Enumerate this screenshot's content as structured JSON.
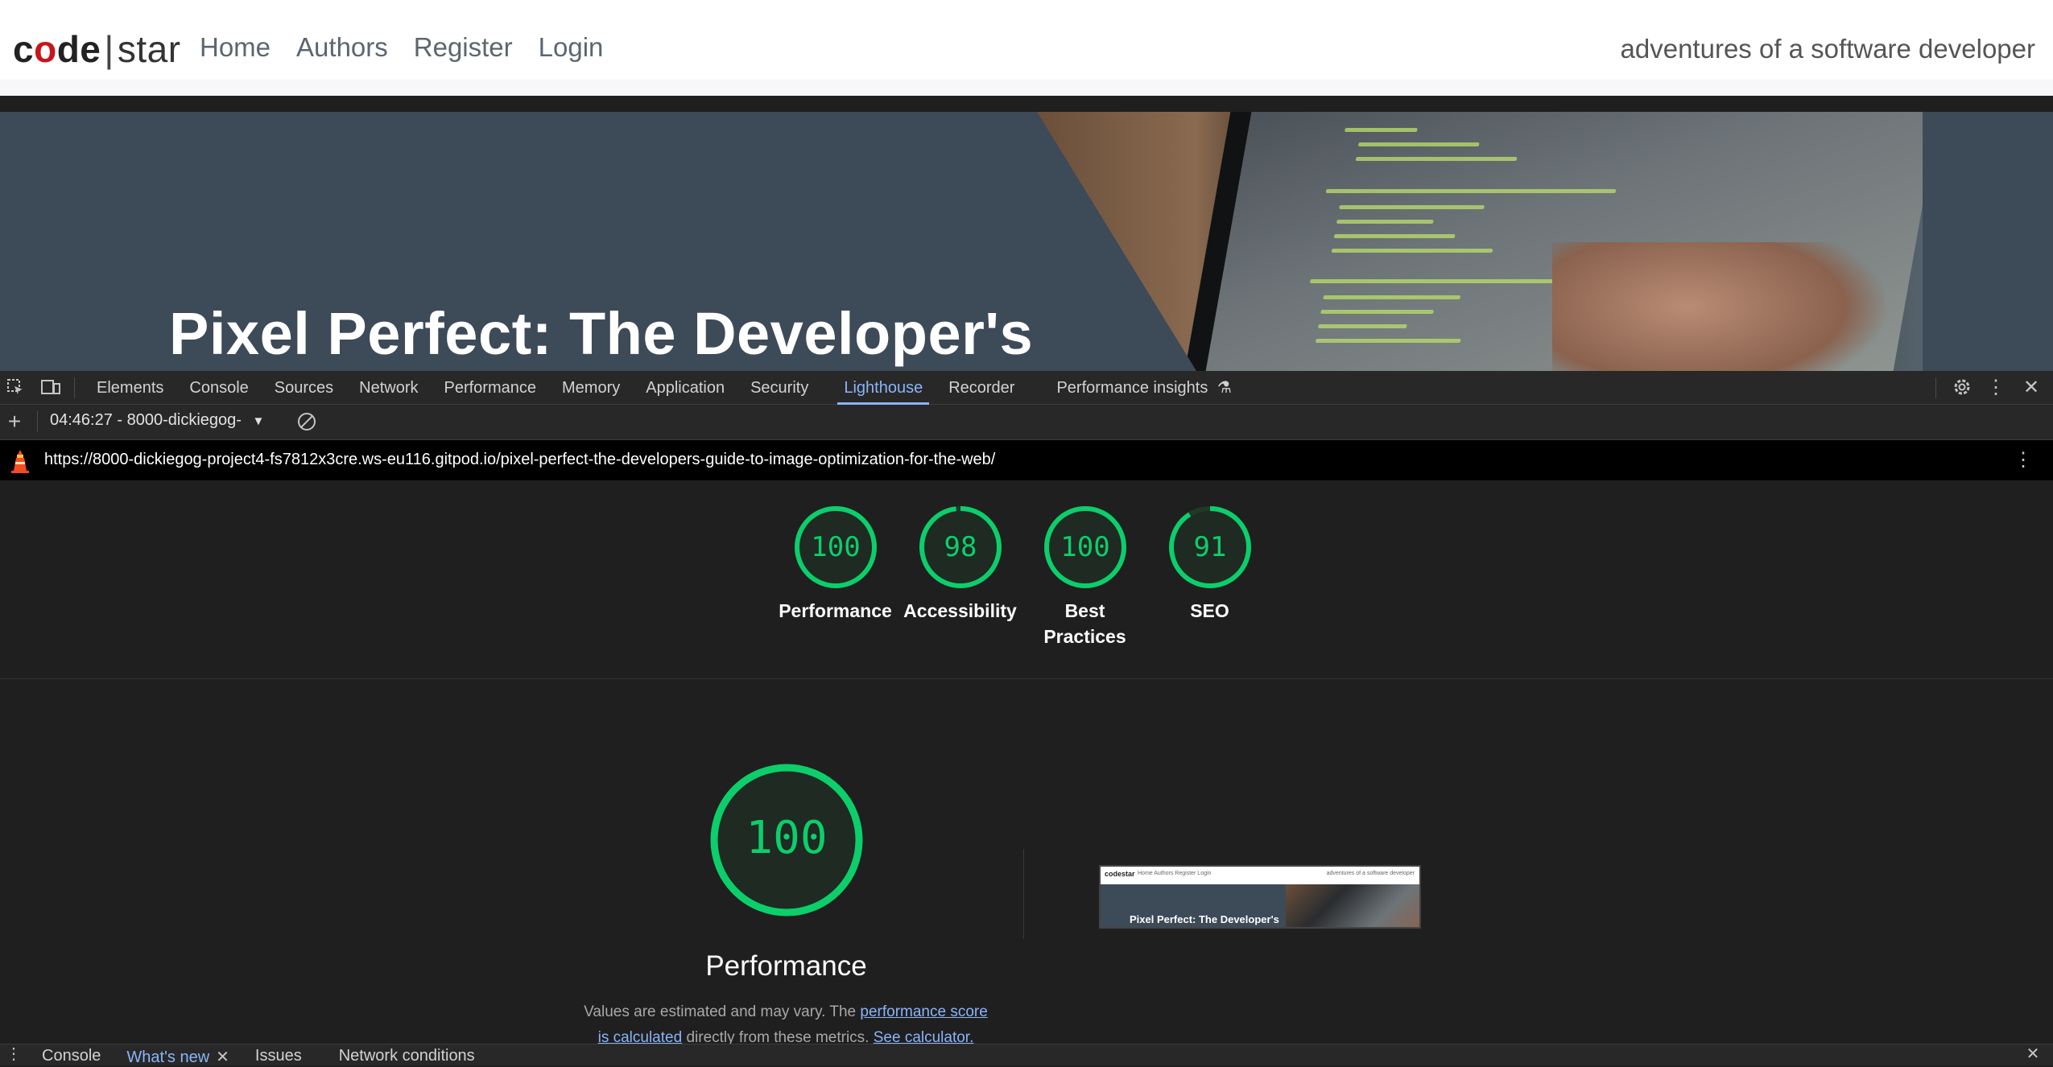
{
  "site": {
    "brand_code_prefix": "c",
    "brand_code_o": "o",
    "brand_code_suffix": "de",
    "brand_sep": "|",
    "brand_star": "star",
    "nav": [
      "Home",
      "Authors",
      "Register",
      "Login"
    ],
    "tagline": "adventures of a software developer",
    "hero_title": "Pixel Perfect: The Developer's"
  },
  "devtools": {
    "tabs": [
      "Elements",
      "Console",
      "Sources",
      "Network",
      "Performance",
      "Memory",
      "Application",
      "Security",
      "Lighthouse",
      "Recorder",
      "Performance insights"
    ],
    "active_tab": "Lighthouse",
    "report_selector": "04:46:27 - 8000-dickiegog-",
    "url": "https://8000-dickiegog-project4-fs7812x3cre.ws-eu116.gitpod.io/pixel-perfect-the-developers-guide-to-image-optimization-for-the-web/"
  },
  "scores": [
    {
      "label_line1": "Performance",
      "label_line2": "",
      "value": "100",
      "score": 100
    },
    {
      "label_line1": "Accessibility",
      "label_line2": "",
      "value": "98",
      "score": 98
    },
    {
      "label_line1": "Best",
      "label_line2": "Practices",
      "value": "100",
      "score": 100
    },
    {
      "label_line1": "SEO",
      "label_line2": "",
      "value": "91",
      "score": 91
    }
  ],
  "performance": {
    "value": "100",
    "label": "Performance",
    "desc_prefix": "Values are estimated and may vary. The ",
    "desc_link1": "performance score is calculated",
    "desc_middle": " directly from these metrics. ",
    "desc_link2": "See calculator."
  },
  "thumbnail": {
    "brand": "codestar",
    "links": "Home   Authors   Register   Login",
    "tagline": "adventures of a software developer",
    "title": "Pixel Perfect: The Developer's"
  },
  "drawer": {
    "tabs": [
      "Console",
      "What's new",
      "Issues",
      "Network conditions"
    ],
    "active": "What's new"
  },
  "colors": {
    "pass": "#0cce6b",
    "link": "#8ab4f8"
  }
}
